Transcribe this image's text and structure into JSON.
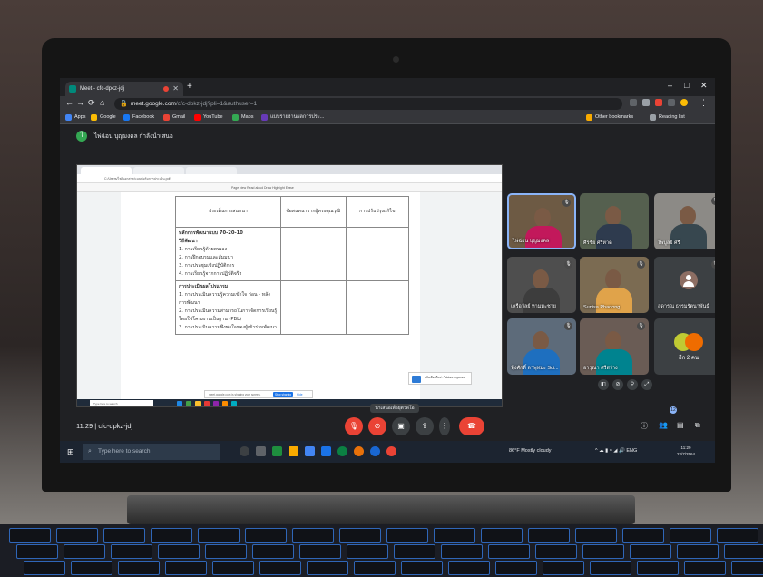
{
  "browser": {
    "tab_title": "Meet - cfc-dpkz-jdj",
    "url_host": "meet.google.com",
    "url_path": "/cfc-dpkz-jdj?pli=1&authuser=1",
    "window_controls": [
      "–",
      "□",
      "✕"
    ],
    "bookmarks": [
      {
        "label": "Apps",
        "icon": "apps-grid-icon",
        "color": "#4285f4"
      },
      {
        "label": "Google",
        "icon": "google-icon",
        "color": "#fbbc05"
      },
      {
        "label": "Facebook",
        "icon": "facebook-icon",
        "color": "#1877f2"
      },
      {
        "label": "Gmail",
        "icon": "gmail-icon",
        "color": "#ea4335"
      },
      {
        "label": "YouTube",
        "icon": "youtube-icon",
        "color": "#ff0000"
      },
      {
        "label": "Maps",
        "icon": "maps-icon",
        "color": "#34a853"
      },
      {
        "label": "แบบรายงานผลการประ...",
        "icon": "forms-icon",
        "color": "#673ab7"
      }
    ],
    "other_bookmarks": "Other bookmarks",
    "reading_list": "Reading list"
  },
  "meet": {
    "presenter_banner": "ไพ่ฉ่อน บุญมงคล กำลังนำเสนอ",
    "presenter_initial": "ไ",
    "meeting_time": "11:29",
    "meeting_code": "cfc-dpkz-jdj",
    "present_tooltip": "นำเสนอเพื่อยุติวิดีโอ",
    "participants_badge": "12",
    "more_label": "อีก 2 คน",
    "participants": [
      {
        "name": "ไพ่ฉ่อน บุญมงคล",
        "bg": "#6d5a44",
        "shirt": "#c2185b",
        "active": true
      },
      {
        "name": "ศิรชัย ศรีหาด",
        "bg": "#55604f",
        "shirt": "#2e3b4e",
        "active": false
      },
      {
        "name": "ไพบูลย์ ศรี",
        "bg": "#8c8a86",
        "shirt": "#37474f",
        "active": false
      },
      {
        "name": "เครือวัลย์ ทามมะชาย",
        "bg": "#4e4e4e",
        "shirt": "#3d3d3d",
        "active": false
      },
      {
        "name": "Sunisa Phadong",
        "bg": "#7b6b52",
        "shirt": "#e0a34a",
        "active": false
      },
      {
        "name": "สุดารณ ธรรมรัตนาพันธ์",
        "bg": "#3c4043",
        "shirt": "",
        "active": false
      },
      {
        "name": "ฟุ้งศักดิ์ ลาพุทมะ Sci...",
        "bg": "#5d6b7a",
        "shirt": "#1e6fbf",
        "active": false
      },
      {
        "name": "อารุณา ศรีสว่าง",
        "bg": "#6a5c55",
        "shirt": "#00838f",
        "active": false
      }
    ]
  },
  "shared_screen": {
    "inner_url": "C:/Users/ไฟล์เอกสาร/แบบฟอร์มการประเมิน.pdf",
    "inner_toolbar": "Page view   Read aloud   Draw   Highlight   Erase",
    "table": {
      "headers": [
        "ประเด็นการสนทนา",
        "ข้อสนทนาจากผู้ทรงคุณวุฒิ",
        "การปรับปรุงแก้ไข"
      ],
      "section1_title": "หลักการพัฒนาแบบ 70-20-10",
      "section1_sub": "วิธีพัฒนา",
      "section1_items": [
        "1. การเรียนรู้ด้วยตนเอง",
        "2. การฝึกอบรมและสัมมนา",
        "3. การประชุมเชิงปฏิบัติการ",
        "4. การเรียนรู้จากการปฏิบัติจริง"
      ],
      "section2_title": "การประเมินผลโปรแกรม",
      "section2_items": [
        "1. การประเมินความรู้ความเข้าใจ ก่อน - หลัง การพัฒนา",
        "2. การประเมินความสามารถในการจัดการเรียนรู้โดยใช้โครงงานเป็นฐาน (PBL)",
        "3. การประเมินความพึงพอใจของผู้เข้าร่วมพัฒนา"
      ]
    },
    "share_notice": "meet.google.com is sharing your screen.",
    "stop_sharing": "Stop sharing",
    "hide": "Hide",
    "notification": "แจ้งเตือนใหม่ - ไพ่ฉ่อน บุญมงคล",
    "inner_search": "Type here to search"
  },
  "taskbar": {
    "search_placeholder": "Type here to search",
    "weather": "86°F  Mostly cloudy",
    "lang": "ENG",
    "time": "11:29",
    "date": "22/7/2564"
  }
}
